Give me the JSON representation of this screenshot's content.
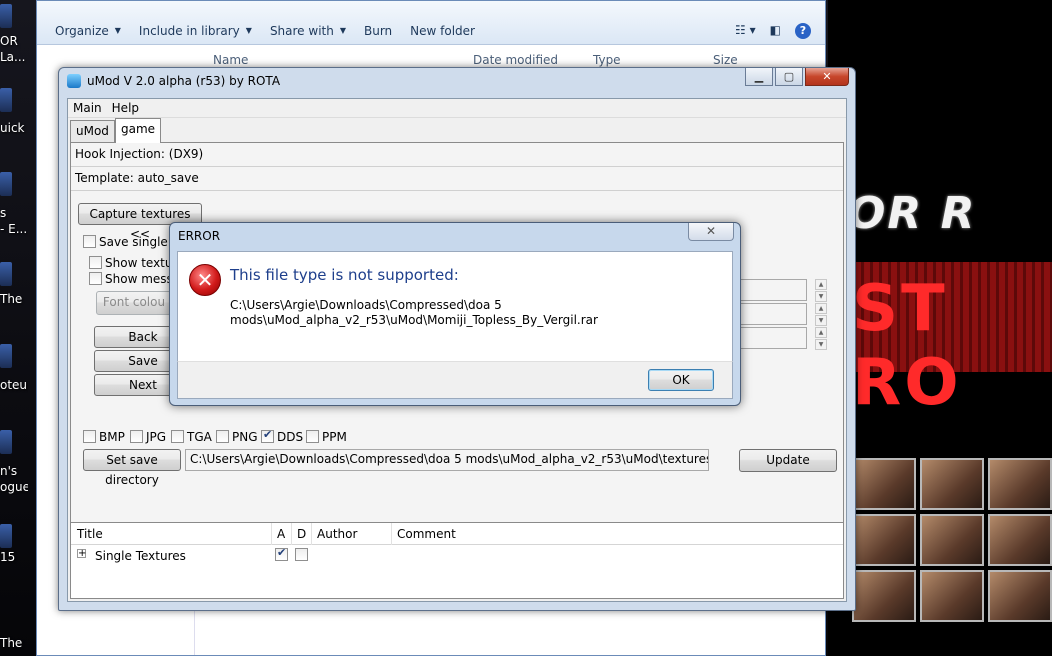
{
  "desktop": {
    "icon_labels": [
      "OR",
      "La...",
      "uick",
      "s",
      "- E...",
      "The",
      "oteur",
      "n's",
      "ogue",
      "15",
      "The"
    ]
  },
  "explorer": {
    "toolbar": {
      "organize": "Organize",
      "include_in_library": "Include in library",
      "share_with": "Share with",
      "burn": "Burn",
      "new_folder": "New folder"
    },
    "columns": [
      "Name",
      "Date modified",
      "Type",
      "Size"
    ]
  },
  "umod": {
    "title": "uMod V 2.0 alpha (r53)  by  ROTA",
    "menu": [
      "Main",
      "Help"
    ],
    "tabs": [
      "uMod",
      "game"
    ],
    "hook_injection": "Hook Injection:  (DX9)",
    "template": "Template: auto_save",
    "capture_textures_button": "Capture textures <<",
    "save_single": "Save single te",
    "show_textures": "Show texture",
    "show_messages": "Show messa",
    "font_colour_button": "Font colou",
    "back_button": "Back",
    "save_button": "Save",
    "next_button": "Next",
    "formats": [
      {
        "label": "BMP",
        "checked": false
      },
      {
        "label": "JPG",
        "checked": false
      },
      {
        "label": "TGA",
        "checked": false
      },
      {
        "label": "PNG",
        "checked": false
      },
      {
        "label": "DDS",
        "checked": true
      },
      {
        "label": "PPM",
        "checked": false
      }
    ],
    "set_save_directory_button": "Set save directory",
    "save_directory": "C:\\Users\\Argie\\Downloads\\Compressed\\doa 5 mods\\uMod_alpha_v2_r53\\uMod\\textures",
    "update_button": "Update",
    "table": {
      "headers": [
        "Title",
        "A",
        "D",
        "Author",
        "Comment"
      ],
      "rows": [
        {
          "title": "Single Textures",
          "a_checked": true,
          "d_checked": false
        }
      ]
    }
  },
  "error_dialog": {
    "title": "ERROR",
    "heading": "This file type is not supported:",
    "path": "C:\\Users\\Argie\\Downloads\\Compressed\\doa 5 mods\\uMod_alpha_v2_r53\\uMod\\Momiji_Topless_By_Vergil.rar",
    "ok_label": "OK"
  },
  "colors": {
    "accent": "#1e3f8c",
    "error_red": "#d11a1a",
    "window_frame": "#cfdcec"
  }
}
